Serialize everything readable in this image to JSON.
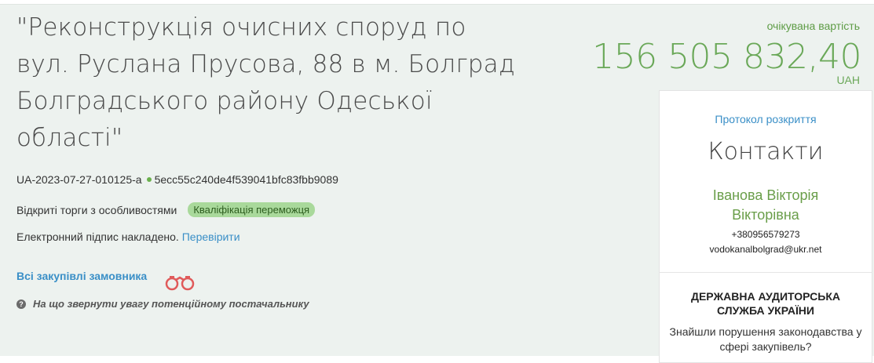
{
  "tender": {
    "title": "\"Реконструкція очисних споруд по вул. Руслана Прусова, 88 в м. Болград Болградського району Одеської області\"",
    "tender_id": "UA-2023-07-27-010125-a",
    "hash": "5ecc55c240de4f539041bfc83fbb9089",
    "procedure": "Відкриті торги з особливостями",
    "status_badge": "Кваліфікація переможця",
    "signature_text": "Електронний підпис накладено.",
    "signature_link": "Перевірити",
    "all_purchases_link": "Всі закупівлі замовника",
    "hint": "На що звернути увагу потенційному постачальнику"
  },
  "price": {
    "label": "очікувана вартість",
    "amount": "156 505 832,40",
    "currency": "UAH"
  },
  "panel": {
    "protocol_link": "Протокол розкриття",
    "contacts_title": "Контакти",
    "contact_name": "Іванова Вікторія Вікторівна",
    "phone": "+380956579273",
    "email": "vodokanalbolgrad@ukr.net",
    "audit_title": "ДЕРЖАВНА АУДИТОРСЬКА СЛУЖБА УКРАЇНИ",
    "audit_text": "Знайшли порушення законодавства у сфері закупівель?"
  },
  "icons": {
    "binoculars": "binoculars-icon",
    "question": "question-circle-icon"
  },
  "colors": {
    "accent_green": "#6aa858",
    "link_blue": "#3a8fc7",
    "badge_green": "#a9d99b",
    "binoculars_red": "#e05a5a",
    "card_bg": "#edf2ef"
  }
}
